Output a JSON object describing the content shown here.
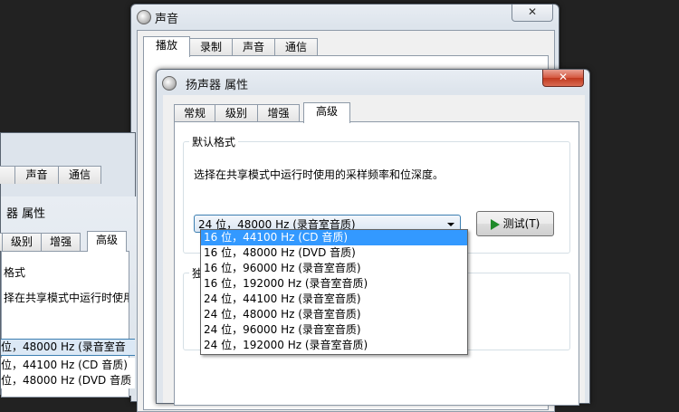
{
  "sound_window": {
    "title": "声音",
    "close": "✕",
    "tabs": [
      "播放",
      "录制",
      "声音",
      "通信"
    ]
  },
  "left_window": {
    "tabs": [
      "声音",
      "通信"
    ],
    "title": "器 属性",
    "inner_tabs": [
      "级别",
      "增强",
      "高级"
    ],
    "group_label": "格式",
    "description": "择在共享模式中运行时使用",
    "combo_value": "位，48000 Hz (录音室音",
    "options": [
      "位，44100 Hz (CD 音质)",
      "位，48000 Hz (DVD 音质"
    ]
  },
  "dialog": {
    "title": "扬声器 属性",
    "close": "✕",
    "tabs": [
      "常规",
      "级别",
      "增强",
      "高级"
    ],
    "group_default_format": "默认格式",
    "description": "选择在共享模式中运行时使用的采样频率和位深度。",
    "combo_value": "24 位，48000 Hz (录音室音质)",
    "test_button": "测试(T)",
    "group2_label": "独",
    "options": [
      "16 位，44100 Hz (CD 音质)",
      "16 位，48000 Hz (DVD 音质)",
      "16 位，96000 Hz (录音室音质)",
      "16 位，192000 Hz (录音室音质)",
      "24 位，44100 Hz (录音室音质)",
      "24 位，48000 Hz (录音室音质)",
      "24 位，96000 Hz (录音室音质)",
      "24 位，192000 Hz (录音室音质)"
    ],
    "selected_index": 0
  }
}
